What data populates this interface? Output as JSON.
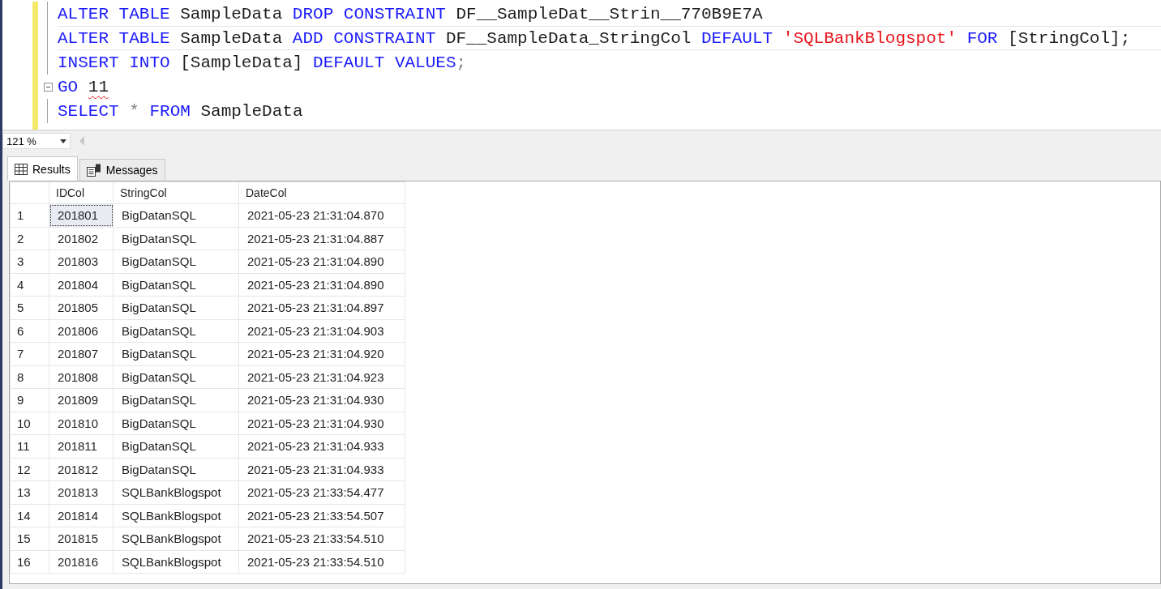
{
  "editor": {
    "lines": [
      {
        "current": false,
        "fold": false,
        "tokens": [
          {
            "kind": "keyword",
            "text": "ALTER TABLE"
          },
          {
            "kind": "plain",
            "text": " SampleData "
          },
          {
            "kind": "keyword",
            "text": "DROP CONSTRAINT"
          },
          {
            "kind": "plain",
            "text": " DF__SampleDat__Strin__770B9E7A"
          }
        ]
      },
      {
        "current": true,
        "fold": false,
        "tokens": [
          {
            "kind": "keyword",
            "text": "ALTER TABLE"
          },
          {
            "kind": "plain",
            "text": " SampleData "
          },
          {
            "kind": "keyword",
            "text": "ADD CONSTRAINT"
          },
          {
            "kind": "plain",
            "text": " DF__SampleData_StringCol "
          },
          {
            "kind": "keyword",
            "text": "DEFAULT "
          },
          {
            "kind": "string",
            "text": "'SQLBankBlogspot' "
          },
          {
            "kind": "keyword",
            "text": "FOR"
          },
          {
            "kind": "plain",
            "text": " [StringCol];"
          }
        ]
      },
      {
        "current": false,
        "fold": false,
        "tokens": [
          {
            "kind": "keyword",
            "text": "INSERT INTO"
          },
          {
            "kind": "plain",
            "text": " [SampleData] "
          },
          {
            "kind": "keyword",
            "text": "DEFAULT VALUES"
          },
          {
            "kind": "operator",
            "text": ";"
          }
        ]
      },
      {
        "current": false,
        "fold": true,
        "tokens": [
          {
            "kind": "keyword",
            "text": "GO "
          },
          {
            "kind": "flagged",
            "text": "11"
          }
        ]
      },
      {
        "current": false,
        "fold": false,
        "tokens": [
          {
            "kind": "keyword",
            "text": "SELECT "
          },
          {
            "kind": "operator",
            "text": "* "
          },
          {
            "kind": "keyword",
            "text": "FROM"
          },
          {
            "kind": "plain",
            "text": " SampleData"
          }
        ]
      }
    ]
  },
  "zoom": "121 %",
  "tabs": [
    {
      "label": "Results",
      "selected": true
    },
    {
      "label": "Messages",
      "selected": false
    }
  ],
  "grid": {
    "columns": [
      "IDCol",
      "StringCol",
      "DateCol"
    ],
    "rows": [
      {
        "num": "1",
        "focused": true,
        "cells": [
          "201801",
          "BigDatanSQL",
          "2021-05-23 21:31:04.870"
        ]
      },
      {
        "num": "2",
        "focused": false,
        "cells": [
          "201802",
          "BigDatanSQL",
          "2021-05-23 21:31:04.887"
        ]
      },
      {
        "num": "3",
        "focused": false,
        "cells": [
          "201803",
          "BigDatanSQL",
          "2021-05-23 21:31:04.890"
        ]
      },
      {
        "num": "4",
        "focused": false,
        "cells": [
          "201804",
          "BigDatanSQL",
          "2021-05-23 21:31:04.890"
        ]
      },
      {
        "num": "5",
        "focused": false,
        "cells": [
          "201805",
          "BigDatanSQL",
          "2021-05-23 21:31:04.897"
        ]
      },
      {
        "num": "6",
        "focused": false,
        "cells": [
          "201806",
          "BigDatanSQL",
          "2021-05-23 21:31:04.903"
        ]
      },
      {
        "num": "7",
        "focused": false,
        "cells": [
          "201807",
          "BigDatanSQL",
          "2021-05-23 21:31:04.920"
        ]
      },
      {
        "num": "8",
        "focused": false,
        "cells": [
          "201808",
          "BigDatanSQL",
          "2021-05-23 21:31:04.923"
        ]
      },
      {
        "num": "9",
        "focused": false,
        "cells": [
          "201809",
          "BigDatanSQL",
          "2021-05-23 21:31:04.930"
        ]
      },
      {
        "num": "10",
        "focused": false,
        "cells": [
          "201810",
          "BigDatanSQL",
          "2021-05-23 21:31:04.930"
        ]
      },
      {
        "num": "11",
        "focused": false,
        "cells": [
          "201811",
          "BigDatanSQL",
          "2021-05-23 21:31:04.933"
        ]
      },
      {
        "num": "12",
        "focused": false,
        "cells": [
          "201812",
          "BigDatanSQL",
          "2021-05-23 21:31:04.933"
        ]
      },
      {
        "num": "13",
        "focused": false,
        "cells": [
          "201813",
          "SQLBankBlogspot",
          "2021-05-23 21:33:54.477"
        ]
      },
      {
        "num": "14",
        "focused": false,
        "cells": [
          "201814",
          "SQLBankBlogspot",
          "2021-05-23 21:33:54.507"
        ]
      },
      {
        "num": "15",
        "focused": false,
        "cells": [
          "201815",
          "SQLBankBlogspot",
          "2021-05-23 21:33:54.510"
        ]
      },
      {
        "num": "16",
        "focused": false,
        "cells": [
          "201816",
          "SQLBankBlogspot",
          "2021-05-23 21:33:54.510"
        ]
      }
    ]
  }
}
